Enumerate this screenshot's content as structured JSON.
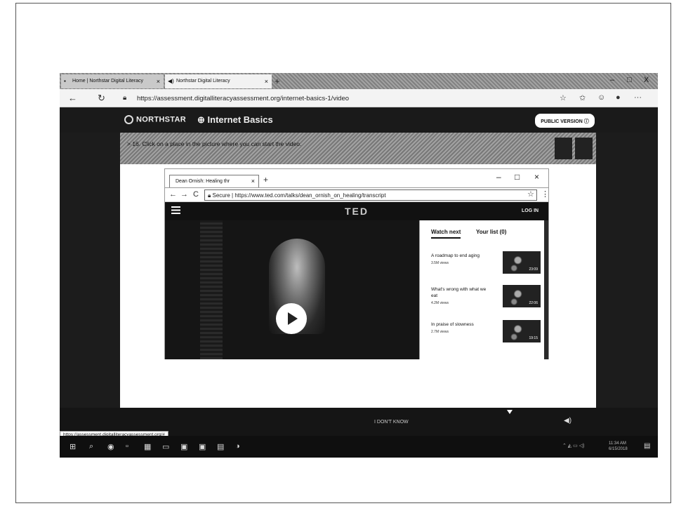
{
  "browser": {
    "tabs": [
      {
        "label": "Home | Northstar Digital Literacy"
      },
      {
        "label": "Northstar Digital Literacy"
      }
    ],
    "new_tab": "+",
    "controls": {
      "minimize": "–",
      "maximize": "□",
      "close": "X"
    },
    "nav": {
      "back": "←",
      "refresh": "↻"
    },
    "url": "https://assessment.digitalliteracyassessment.org/internet-basics-1/video",
    "right_icons": [
      "☆",
      "✩",
      "☺",
      "●",
      "···"
    ]
  },
  "northstar": {
    "logo": "NORTHSTAR",
    "module": "Internet Basics",
    "public_version": "PUBLIC VERSION",
    "question": "16. Click on a place in the picture where you can start the video."
  },
  "inner_browser": {
    "tab_label": "Dean Ornish: Healing thr",
    "new_tab": "+",
    "controls": {
      "minimize": "–",
      "maximize": "□",
      "close": "×"
    },
    "nav": {
      "back": "←",
      "forward": "→",
      "refresh": "C"
    },
    "url": "Secure | https://www.ted.com/talks/dean_ornish_on_healing/transcript",
    "right_icons": [
      "☆",
      "⋮"
    ]
  },
  "ted": {
    "logo": "TED",
    "login": "LOG IN",
    "panel": {
      "tabs": [
        "Watch next",
        "Your list (0)"
      ],
      "items": [
        {
          "title": "A roadmap to end aging",
          "views": "3.5M views",
          "duration": "23:09"
        },
        {
          "title": "What's wrong with what we eat",
          "views": "4.2M views",
          "duration": "22:06"
        },
        {
          "title": "In praise of slowness",
          "views": "2.7M views",
          "duration": "19:15"
        }
      ]
    }
  },
  "bottom": {
    "dont_know": "I DON'T KNOW",
    "status_url": "https://assessment.digitalliteracyassessment.org/#"
  },
  "taskbar": {
    "clock": "11:34 AM\n6/15/2018"
  }
}
